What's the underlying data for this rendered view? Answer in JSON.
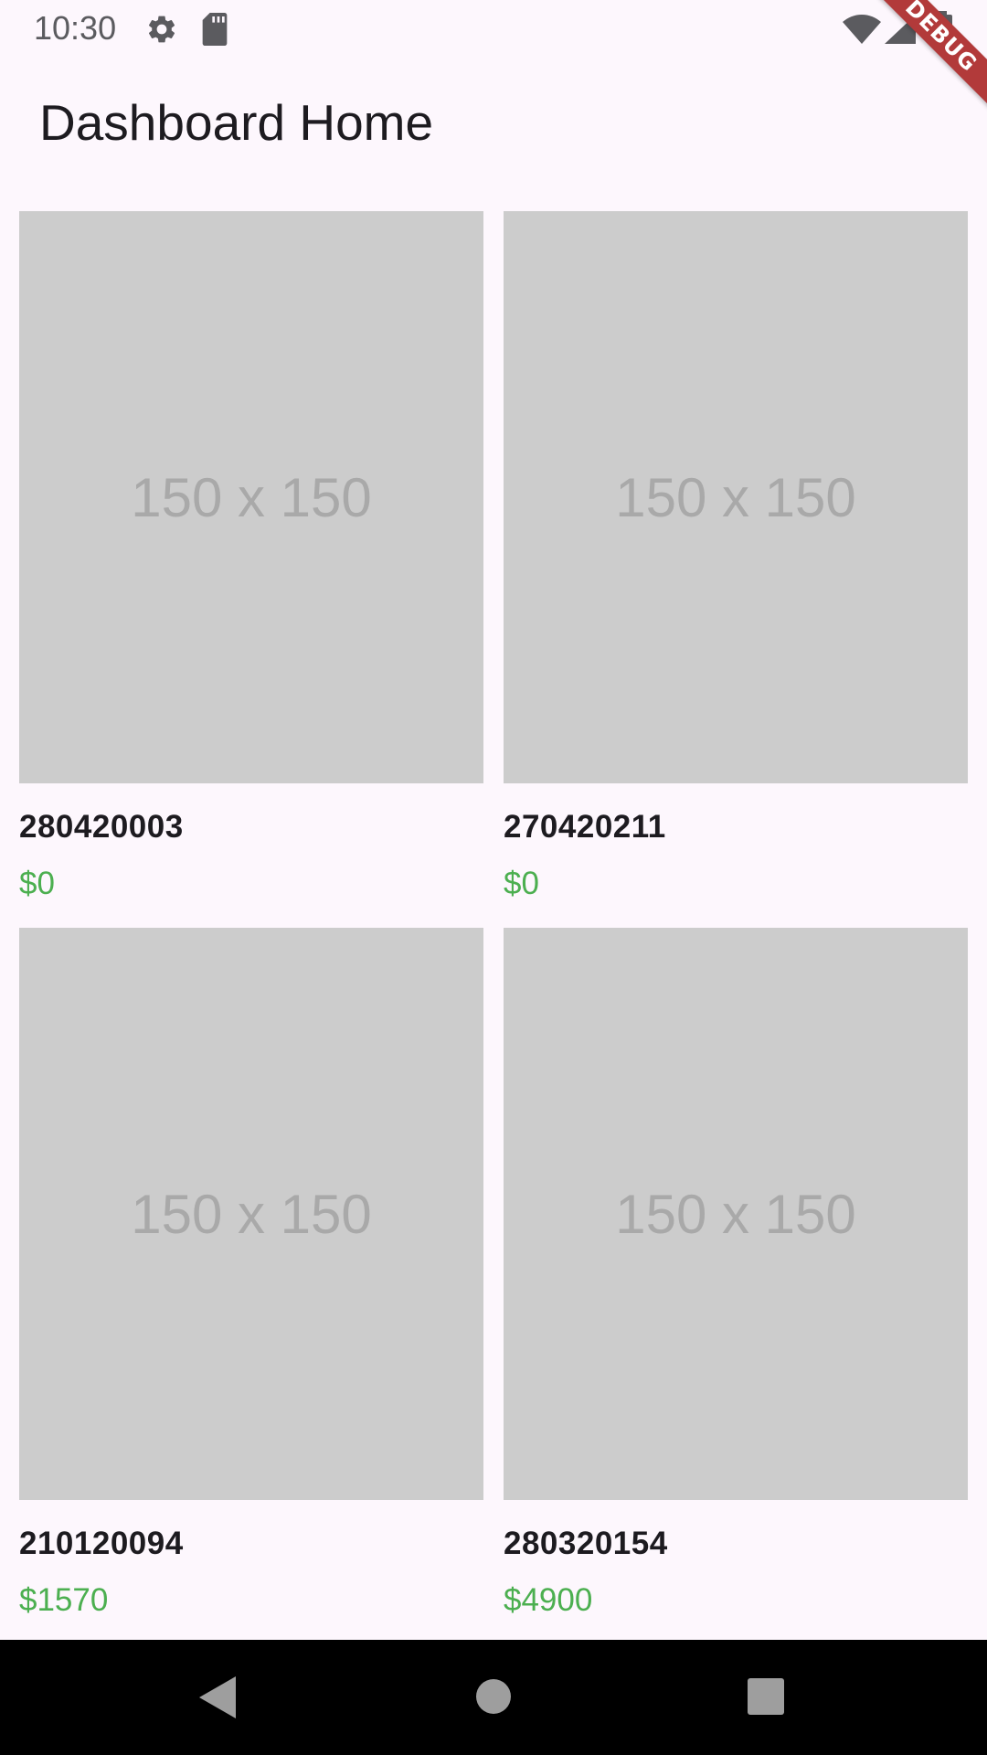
{
  "status_bar": {
    "time": "10:30",
    "icons": [
      "gear-icon",
      "sd-card-icon",
      "wifi-icon",
      "signal-icon",
      "battery-icon"
    ]
  },
  "debug_banner": {
    "label": "DEBUG",
    "color": "#b23a3a"
  },
  "app_bar": {
    "title": "Dashboard Home"
  },
  "products": [
    {
      "image_label": "150 x 150",
      "title": "280420003",
      "price": "$0"
    },
    {
      "image_label": "150 x 150",
      "title": "270420211",
      "price": "$0"
    },
    {
      "image_label": "150 x 150",
      "title": "210120094",
      "price": "$1570"
    },
    {
      "image_label": "150 x 150",
      "title": "280320154",
      "price": "$4900"
    }
  ],
  "colors": {
    "background": "#fdf7fd",
    "price": "#4caf50",
    "placeholder": "#cccccc",
    "nav_bar": "#000000"
  },
  "nav_bar": {
    "icons": [
      "back-icon",
      "home-icon",
      "recents-icon"
    ]
  }
}
